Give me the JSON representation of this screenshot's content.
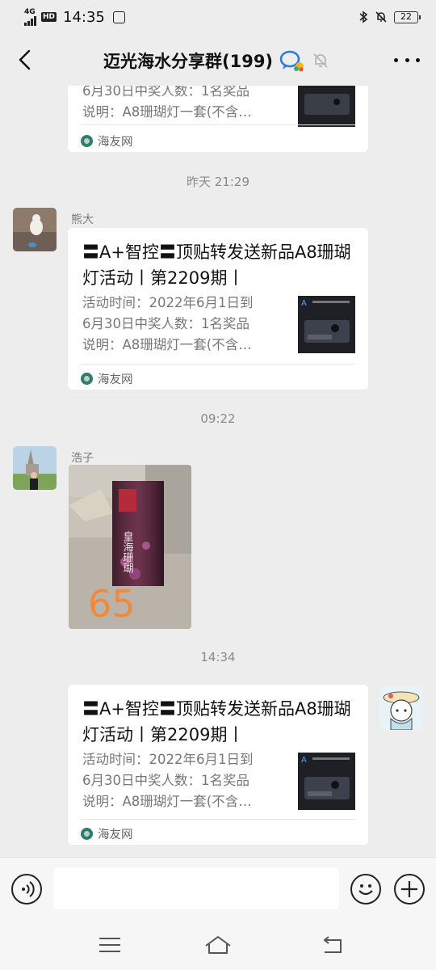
{
  "status_bar": {
    "network": "4G",
    "hd": "HD",
    "time": "14:35",
    "battery": "22"
  },
  "header": {
    "title": "迈光海水分享群(199)"
  },
  "chat": {
    "top_card": {
      "desc_partial": "6月30日中奖人数：1名奖品",
      "desc_line2": "说明：A8珊瑚灯一套(不含…",
      "source": "海友网"
    },
    "timestamps": [
      "昨天 21:29",
      "09:22",
      "14:34"
    ],
    "message1": {
      "sender": "熊大",
      "title": "〓A+智控〓顶贴转发送新品A8珊瑚灯活动丨第2209期丨",
      "desc": "活动时间：2022年6月1日到\n6月30日中奖人数：1名奖品\n说明：A8珊瑚灯一套(不含…",
      "source": "海友网"
    },
    "message2": {
      "sender": "浩子",
      "photo_text": "皇海珊瑚",
      "handwriting": "65"
    },
    "message3": {
      "title": "〓A+智控〓顶贴转发送新品A8珊瑚灯活动丨第2209期丨",
      "desc": "活动时间：2022年6月1日到\n6月30日中奖人数：1名奖品\n说明：A8珊瑚灯一套(不含…",
      "source": "海友网"
    }
  },
  "input_bar": {
    "message_value": ""
  },
  "colors": {
    "background": "#ededed",
    "card": "#ffffff",
    "timestamp": "#8a8a8a"
  }
}
